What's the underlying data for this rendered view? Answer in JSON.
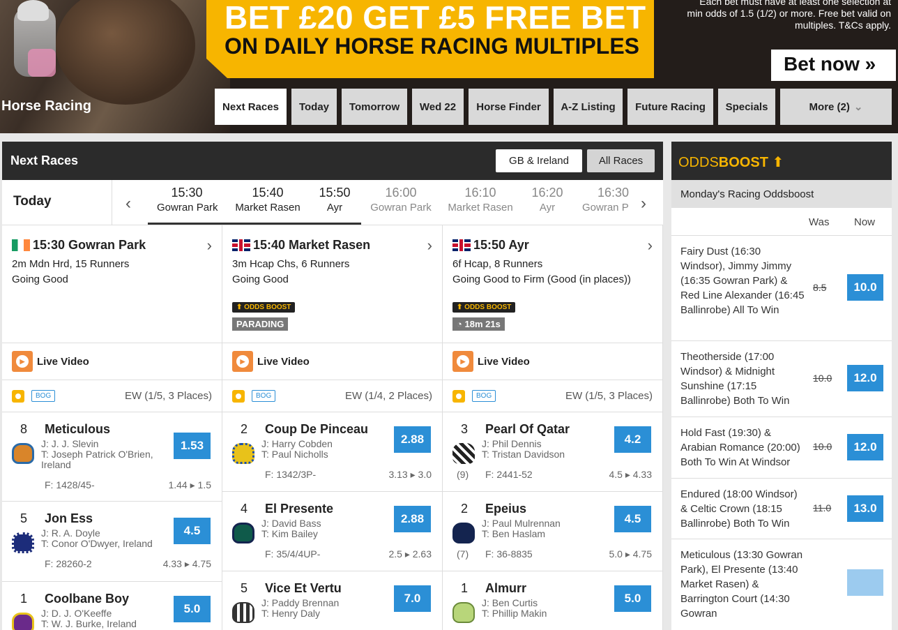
{
  "promo": {
    "headline": "BET £20 GET £5 FREE BET",
    "subhead": "ON DAILY HORSE RACING MULTIPLES",
    "terms": "Each bet must have at least one selection at min odds of 1.5 (1/2) or more. Free bet valid on multiples. T&Cs apply.",
    "cta": "Bet now"
  },
  "page": {
    "title": "Horse Racing"
  },
  "nav": [
    {
      "label": "Next Races",
      "active": true
    },
    {
      "label": "Today"
    },
    {
      "label": "Tomorrow"
    },
    {
      "label": "Wed 22"
    },
    {
      "label": "Horse Finder"
    },
    {
      "label": "A-Z Listing"
    },
    {
      "label": "Future Racing"
    },
    {
      "label": "Specials"
    },
    {
      "label": "More (2)"
    }
  ],
  "next_races": {
    "title": "Next Races",
    "filters": [
      {
        "label": "GB & Ireland",
        "active": true
      },
      {
        "label": "All Races"
      }
    ],
    "day": "Today",
    "times": [
      {
        "time": "15:30",
        "venue": "Gowran Park"
      },
      {
        "time": "15:40",
        "venue": "Market Rasen"
      },
      {
        "time": "15:50",
        "venue": "Ayr"
      },
      {
        "time": "16:00",
        "venue": "Gowran Park"
      },
      {
        "time": "16:10",
        "venue": "Market Rasen"
      },
      {
        "time": "16:20",
        "venue": "Ayr"
      },
      {
        "time": "16:30",
        "venue": "Gowran P"
      }
    ],
    "races": [
      {
        "title": "15:30 Gowran Park",
        "flag": "ie",
        "info": "2m Mdn Hrd, 15 Runners",
        "going": "Going Good",
        "live": "Live Video",
        "bog": "BOG",
        "ew": "EW (1/5, 3 Places)",
        "runners": [
          {
            "no": "8",
            "name": "Meticulous",
            "jockey": "J: J. J. Slevin",
            "trainer": "T: Joseph Patrick O'Brien, Ireland",
            "odds": "1.53",
            "form": "F: 1428/45-",
            "drift_from": "1.44",
            "drift_to": "1.5",
            "draw": "",
            "silk": "#d9852a"
          },
          {
            "no": "5",
            "name": "Jon Ess",
            "jockey": "J: R. A. Doyle",
            "trainer": "T: Conor O'Dwyer, Ireland",
            "odds": "4.5",
            "form": "F: 28260-2",
            "drift_from": "4.33",
            "drift_to": "4.75",
            "draw": "",
            "silk": "#1c2c7a"
          },
          {
            "no": "1",
            "name": "Coolbane Boy",
            "jockey": "J: D. J. O'Keeffe",
            "trainer": "T: W. J. Burke, Ireland",
            "odds": "5.0",
            "form": "",
            "drift_from": "",
            "drift_to": "",
            "draw": "",
            "silk": "#6a2a8a"
          }
        ]
      },
      {
        "title": "15:40 Market Rasen",
        "flag": "uk",
        "info": "3m Hcap Chs, 6 Runners",
        "going": "Going Good",
        "oddsboost": "ODDS BOOST",
        "status": "PARADING",
        "live": "Live Video",
        "bog": "BOG",
        "ew": "EW (1/4, 2 Places)",
        "runners": [
          {
            "no": "2",
            "name": "Coup De Pinceau",
            "jockey": "J: Harry Cobden",
            "trainer": "T: Paul Nicholls",
            "odds": "2.88",
            "form": "F: 1342/3P-",
            "drift_from": "3.13",
            "drift_to": "3.0",
            "draw": "",
            "silk": "#e8c21a"
          },
          {
            "no": "4",
            "name": "El Presente",
            "jockey": "J: David Bass",
            "trainer": "T: Kim Bailey",
            "odds": "2.88",
            "form": "F: 35/4/4UP-",
            "drift_from": "2.5",
            "drift_to": "2.63",
            "draw": "",
            "silk": "#0f5a4a"
          },
          {
            "no": "5",
            "name": "Vice Et Vertu",
            "jockey": "J: Paddy Brennan",
            "trainer": "T: Henry Daly",
            "odds": "7.0",
            "form": "",
            "drift_from": "",
            "drift_to": "",
            "draw": "",
            "silk": "#333333"
          }
        ]
      },
      {
        "title": "15:50 Ayr",
        "flag": "uk",
        "info": "6f Hcap, 8 Runners",
        "going": "Going Good to Firm (Good (in places))",
        "oddsboost": "ODDS BOOST",
        "status": "18m 21s",
        "live": "Live Video",
        "bog": "BOG",
        "ew": "EW (1/5, 3 Places)",
        "runners": [
          {
            "no": "3",
            "name": "Pearl Of Qatar",
            "jockey": "J: Phil Dennis",
            "trainer": "T: Tristan Davidson",
            "odds": "4.2",
            "form": "F: 2441-52",
            "drift_from": "4.5",
            "drift_to": "4.33",
            "draw": "(9)",
            "silk": "#222222"
          },
          {
            "no": "2",
            "name": "Epeius",
            "jockey": "J: Paul Mulrennan",
            "trainer": "T: Ben Haslam",
            "odds": "4.5",
            "form": "F: 36-8835",
            "drift_from": "5.0",
            "drift_to": "4.75",
            "draw": "(7)",
            "silk": "#14244f"
          },
          {
            "no": "1",
            "name": "Almurr",
            "jockey": "J: Ben Curtis",
            "trainer": "T: Phillip Makin",
            "odds": "5.0",
            "form": "",
            "drift_from": "",
            "drift_to": "",
            "draw": "",
            "silk": "#b8d67a"
          }
        ]
      }
    ]
  },
  "oddsboost": {
    "logo_a": "ODDS",
    "logo_b": "BOOST",
    "subtitle": "Monday's Racing Oddsboost",
    "col_was": "Was",
    "col_now": "Now",
    "items": [
      {
        "text": "Fairy Dust (16:30 Windsor), Jimmy Jimmy (16:35 Gowran Park) & Red Line Alexander (16:45 Ballinrobe) All To Win",
        "was": "8.5",
        "now": "10.0"
      },
      {
        "text": "Theotherside (17:00 Windsor) & Midnight Sunshine (17:15 Ballinrobe) Both To Win",
        "was": "10.0",
        "now": "12.0"
      },
      {
        "text": "Hold Fast (19:30) & Arabian Romance (20:00) Both To Win At Windsor",
        "was": "10.0",
        "now": "12.0"
      },
      {
        "text": "Endured (18:00 Windsor) & Celtic Crown (18:15 Ballinrobe) Both To Win",
        "was": "11.0",
        "now": "13.0"
      },
      {
        "text": "Meticulous (13:30 Gowran Park), El Presente (13:40 Market Rasen) & Barrington Court (14:30 Gowran",
        "was": "",
        "now": ""
      }
    ]
  },
  "colors": {
    "accent": "#2b8fd6",
    "brand": "#f7b500",
    "dark": "#2b2b2b"
  }
}
